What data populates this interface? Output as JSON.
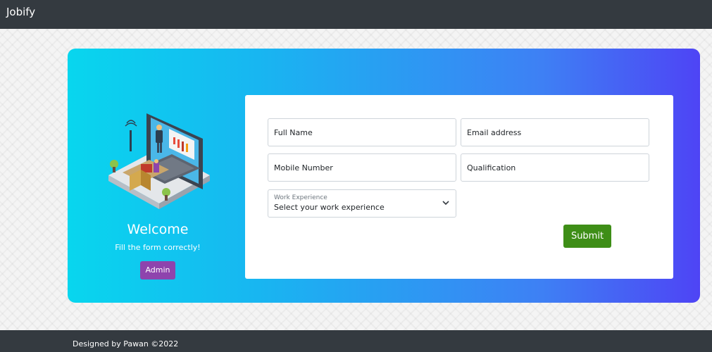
{
  "navbar": {
    "brand": "Jobify"
  },
  "hero": {
    "welcome": "Welcome",
    "subtitle": "Fill the form correctly!",
    "admin_label": "Admin",
    "illustration_icon": "laptop-office-illustration"
  },
  "form": {
    "full_name": {
      "placeholder": "Full Name",
      "value": ""
    },
    "email": {
      "placeholder": "Email address",
      "value": ""
    },
    "mobile": {
      "placeholder": "Mobile Number",
      "value": ""
    },
    "qualification": {
      "placeholder": "Qualification",
      "value": ""
    },
    "experience": {
      "label": "Work Experience",
      "selected": "Select your work experience",
      "icon": "chevron-down-icon"
    },
    "submit_label": "Submit"
  },
  "footer": {
    "text": "Designed by Pawan ©2022"
  },
  "colors": {
    "navbar": "#343a40",
    "gradient_start": "#08d6ee",
    "gradient_end": "#4e44f5",
    "admin_button": "#8e44ad",
    "submit_button": "#3e8e17"
  }
}
